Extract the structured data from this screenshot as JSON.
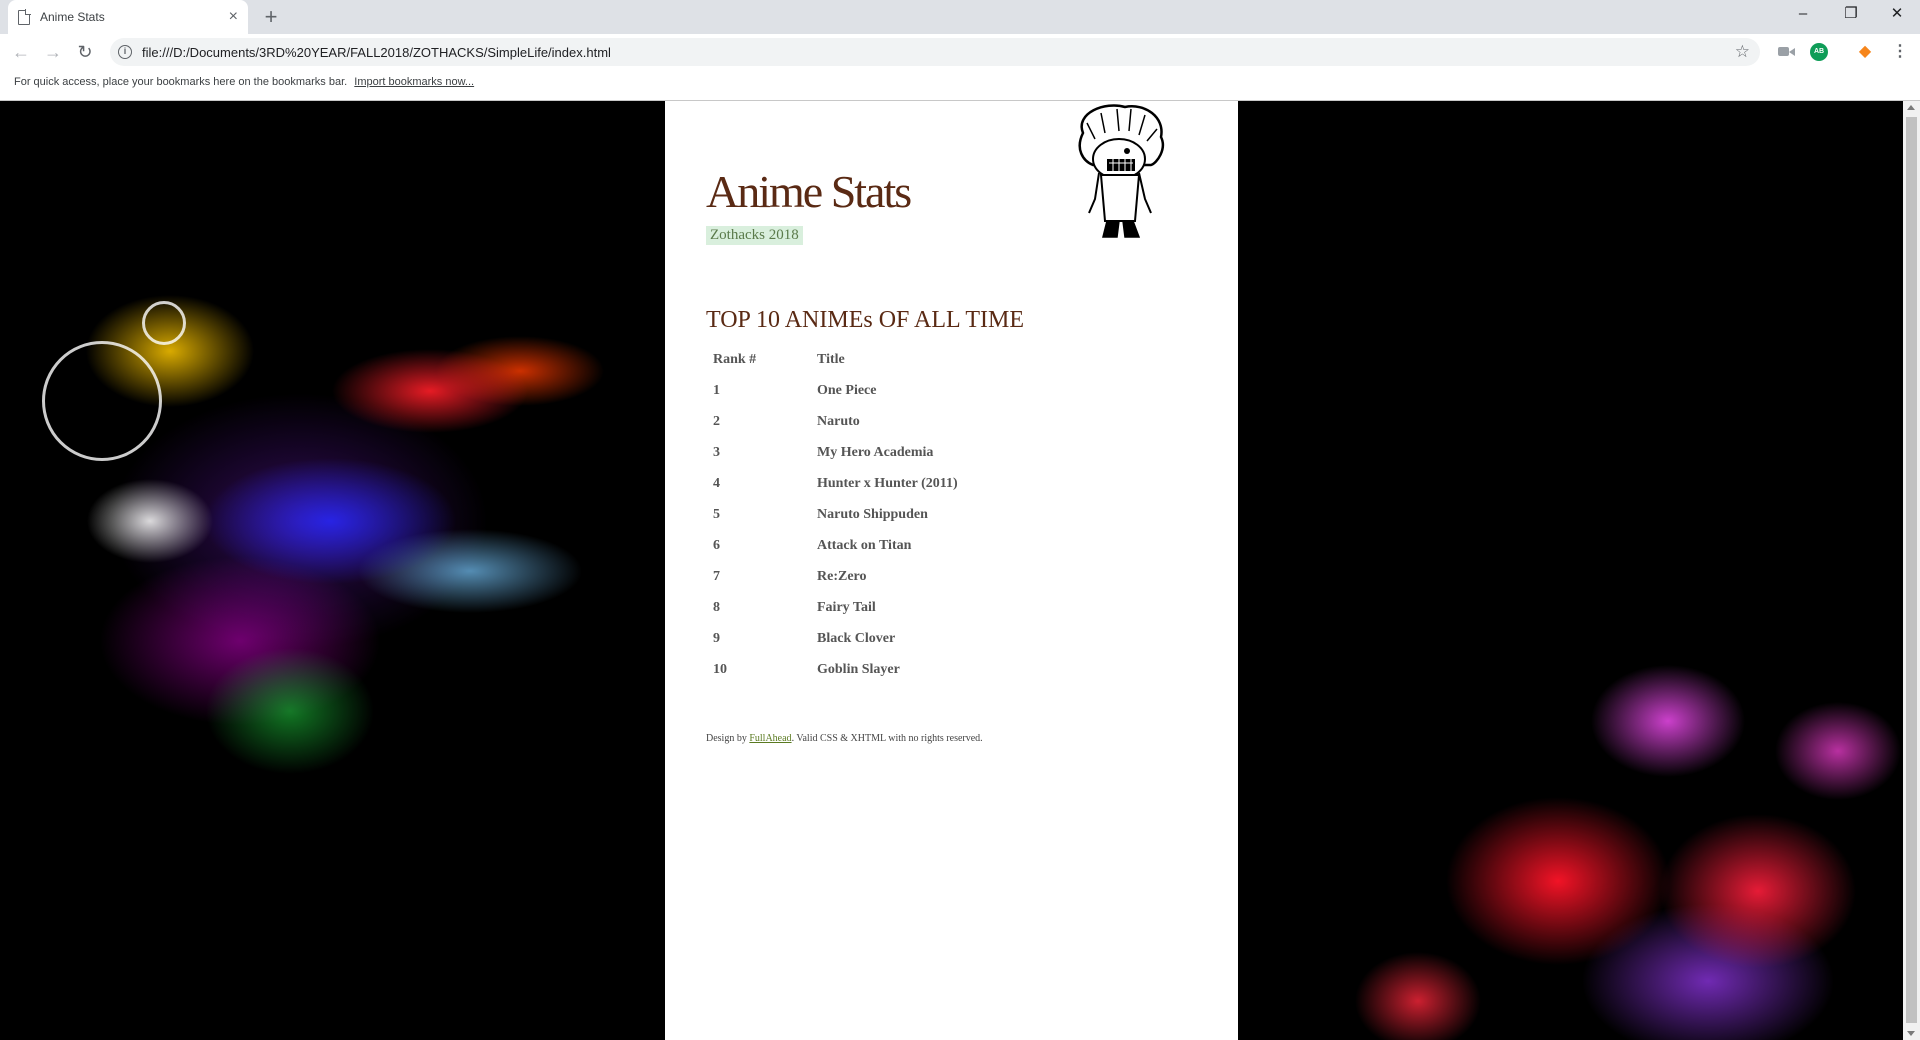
{
  "browser": {
    "tab_title": "Anime Stats",
    "tab_close": "×",
    "new_tab": "+",
    "window_minimize": "–",
    "window_restore": "❐",
    "window_close": "✕",
    "back": "←",
    "forward": "→",
    "reload": "↻",
    "url": "file:///D:/Documents/3RD%20YEAR/FALL2018/ZOTHACKS/SimpleLife/index.html",
    "extension_badge": "AB",
    "bookmarks_bar_text": "For quick access, place your bookmarks here on the bookmarks bar.",
    "import_bookmarks_link": "Import bookmarks now..."
  },
  "page": {
    "title": "Anime Stats",
    "subtitle": "Zothacks 2018",
    "section_heading": "TOP 10 ANIMEs OF ALL TIME",
    "table": {
      "headers": [
        "Rank #",
        "Title"
      ],
      "rows": [
        [
          "1",
          "One Piece"
        ],
        [
          "2",
          "Naruto"
        ],
        [
          "3",
          "My Hero Academia"
        ],
        [
          "4",
          "Hunter x Hunter (2011)"
        ],
        [
          "5",
          "Naruto Shippuden"
        ],
        [
          "6",
          "Attack on Titan"
        ],
        [
          "7",
          "Re:Zero"
        ],
        [
          "8",
          "Fairy Tail"
        ],
        [
          "9",
          "Black Clover"
        ],
        [
          "10",
          "Goblin Slayer"
        ]
      ]
    },
    "footer": {
      "prefix": "Design by ",
      "link": "FullAhead",
      "suffix": ". Valid CSS & XHTML with no rights reserved."
    }
  },
  "colors": {
    "title_brown": "#5a2a14",
    "subtitle_green": "#5a7a4a",
    "subtitle_bg": "#d9efdd"
  },
  "icons": [
    "page-icon",
    "info-icon",
    "star-icon",
    "camera-icon",
    "metamask-fox-icon",
    "menu-dots-icon"
  ]
}
